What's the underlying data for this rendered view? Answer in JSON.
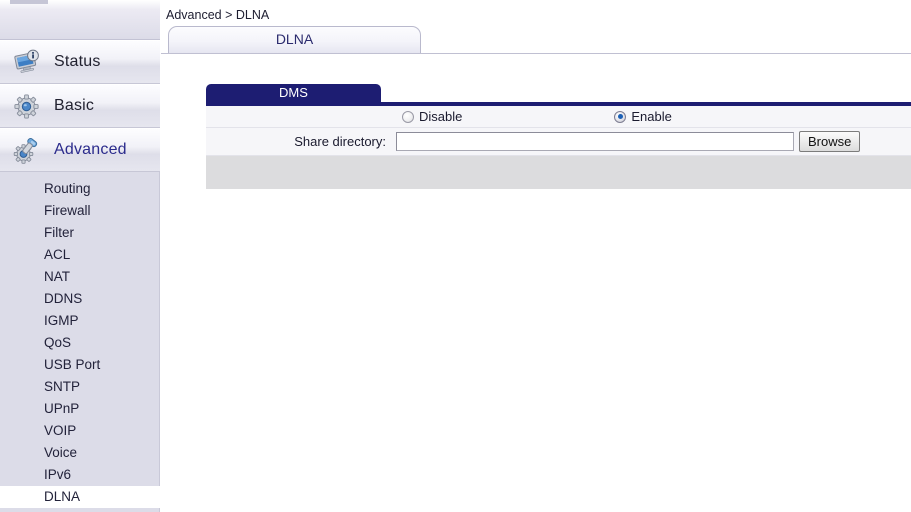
{
  "sidebar": {
    "main_nav": [
      {
        "label": "Status",
        "icon": "monitor-info-icon",
        "active": false
      },
      {
        "label": "Basic",
        "icon": "gear-icon",
        "active": false
      },
      {
        "label": "Advanced",
        "icon": "gear-wrench-icon",
        "active": true
      }
    ],
    "sub_items": [
      {
        "label": "Routing",
        "selected": false
      },
      {
        "label": "Firewall",
        "selected": false
      },
      {
        "label": "Filter",
        "selected": false
      },
      {
        "label": "ACL",
        "selected": false
      },
      {
        "label": "NAT",
        "selected": false
      },
      {
        "label": "DDNS",
        "selected": false
      },
      {
        "label": "IGMP",
        "selected": false
      },
      {
        "label": "QoS",
        "selected": false
      },
      {
        "label": "USB Port",
        "selected": false
      },
      {
        "label": "SNTP",
        "selected": false
      },
      {
        "label": "UPnP",
        "selected": false
      },
      {
        "label": "VOIP",
        "selected": false
      },
      {
        "label": "Voice",
        "selected": false
      },
      {
        "label": "IPv6",
        "selected": false
      },
      {
        "label": "DLNA",
        "selected": true
      }
    ]
  },
  "content": {
    "breadcrumb": "Advanced > DLNA",
    "page_tab": "DLNA",
    "panel": {
      "tab_label": "DMS",
      "radio_options": [
        {
          "label": "Disable",
          "checked": false
        },
        {
          "label": "Enable",
          "checked": true
        }
      ],
      "field_label": "Share directory:",
      "field_value": "",
      "field_placeholder": "",
      "browse_label": "Browse"
    }
  },
  "colors": {
    "panel_tab_navy": "#1d1d72",
    "sidebar_bg": "#dcdce8",
    "radio_on_blue": "#1b5fb5",
    "footer_gray": "#dcdcde"
  }
}
